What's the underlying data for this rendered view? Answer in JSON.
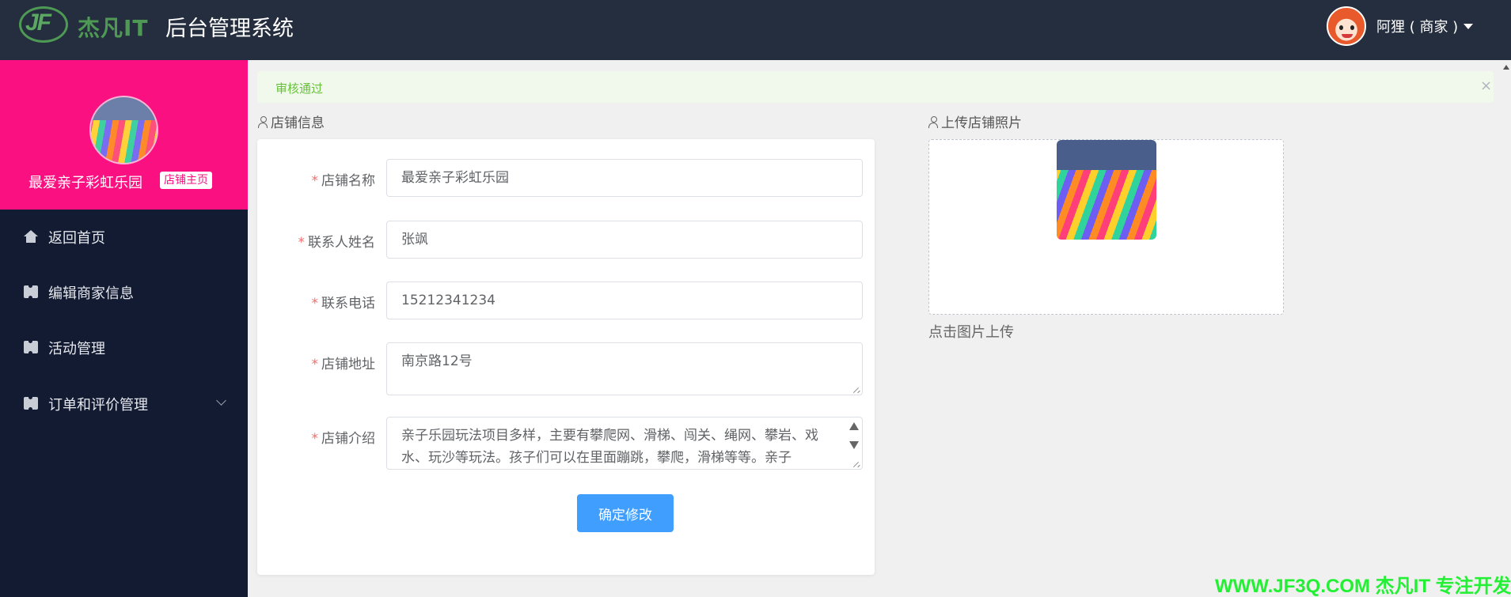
{
  "header": {
    "logo_text": "杰凡IT",
    "logo_mark": "JF",
    "title": "后台管理系统",
    "user_name": "阿狸 ( 商家 )"
  },
  "sidebar": {
    "shop_name": "最爱亲子彩虹乐园",
    "shop_tag": "店铺主页",
    "items": [
      {
        "label": "返回首页",
        "icon": "home-icon"
      },
      {
        "label": "编辑商家信息",
        "icon": "ticket-icon"
      },
      {
        "label": "活动管理",
        "icon": "ticket-icon"
      },
      {
        "label": "订单和评价管理",
        "icon": "ticket-icon",
        "expandable": true
      }
    ]
  },
  "alert": {
    "text": "审核通过",
    "close": "×"
  },
  "store_info": {
    "section_title": "店铺信息",
    "fields": {
      "name": {
        "label": "店铺名称",
        "value": "最爱亲子彩虹乐园"
      },
      "contact": {
        "label": "联系人姓名",
        "value": "张飒"
      },
      "phone": {
        "label": "联系电话",
        "value": "15212341234"
      },
      "address": {
        "label": "店铺地址",
        "value": "南京路12号"
      },
      "intro": {
        "label": "店铺介绍",
        "value": "亲子乐园玩法项目多样，主要有攀爬网、滑梯、闯关、绳网、攀岩、戏水、玩沙等玩法。孩子们可以在里面蹦跳，攀爬，滑梯等等。亲子"
      }
    },
    "required_mark": "*",
    "submit_label": "确定修改"
  },
  "upload": {
    "section_title": "上传店铺照片",
    "hint": "点击图片上传"
  },
  "watermark": "WWW.JF3Q.COM 杰凡IT 专注开发",
  "colors": {
    "header_bg": "#252e3e",
    "sidebar_bg": "#121b32",
    "shop_card_bg": "#fa1080",
    "primary": "#409eff",
    "success_text": "#67c23a",
    "success_bg": "#f0f9eb",
    "required": "#f56c6c"
  }
}
